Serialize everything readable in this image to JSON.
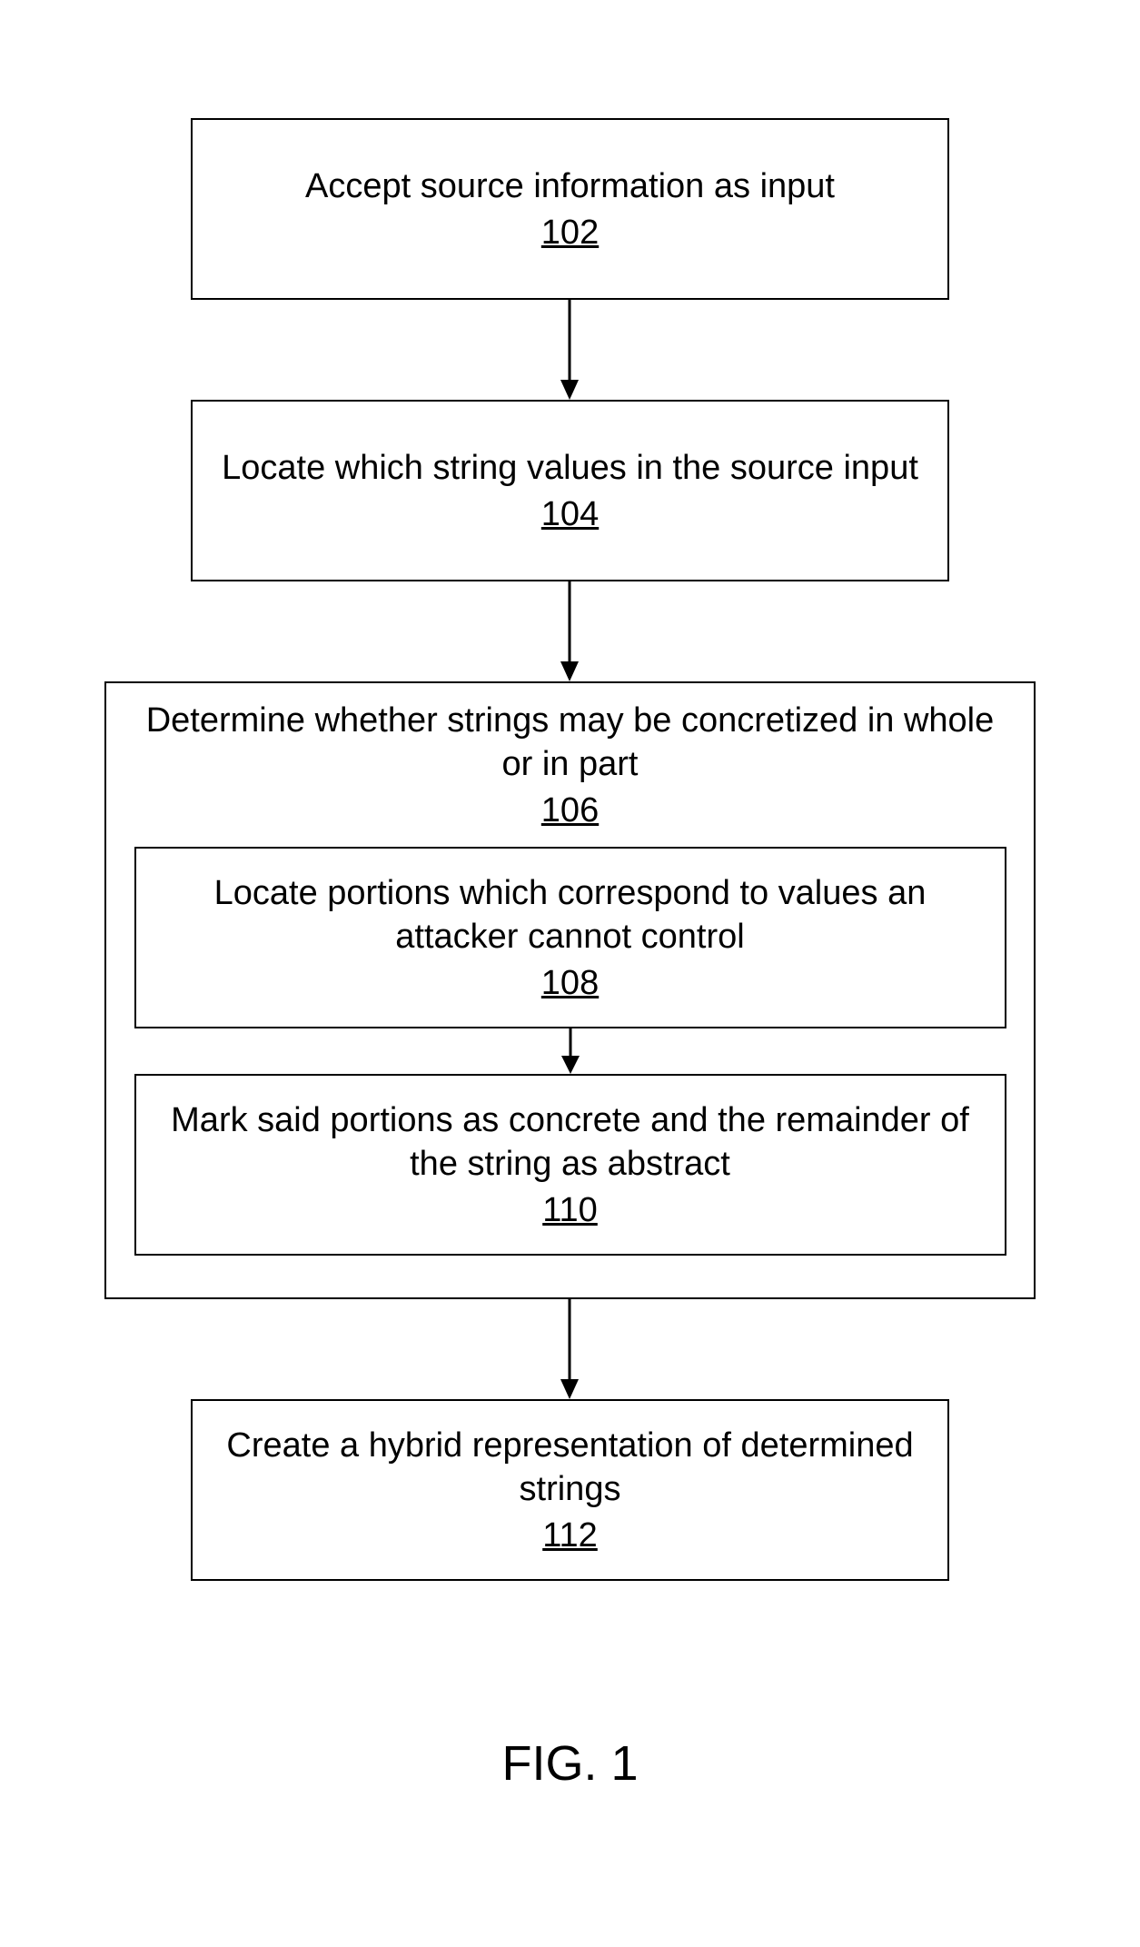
{
  "box102": {
    "text": "Accept source information as input",
    "ref": "102"
  },
  "box104": {
    "text": "Locate which string values in the source input",
    "ref": "104"
  },
  "box106": {
    "text": "Determine whether strings may be concretized in whole or in part",
    "ref": "106"
  },
  "box108": {
    "text": "Locate portions which correspond to values an attacker cannot control",
    "ref": "108"
  },
  "box110": {
    "text": "Mark said portions as concrete and the remainder of the string as abstract",
    "ref": "110"
  },
  "box112": {
    "text": "Create a hybrid representation of determined strings",
    "ref": "112"
  },
  "figure_label": "FIG. 1"
}
